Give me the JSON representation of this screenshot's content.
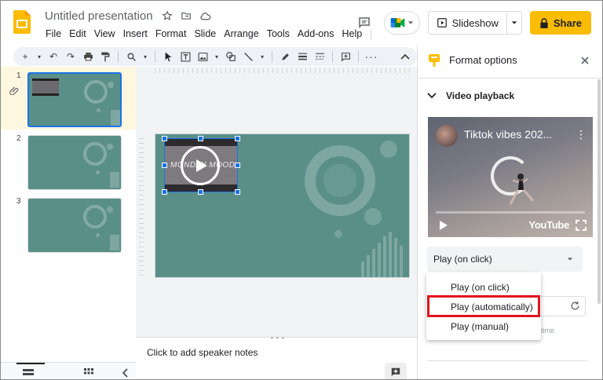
{
  "header": {
    "title": "Untitled presentation",
    "menu": [
      "File",
      "Edit",
      "View",
      "Insert",
      "Format",
      "Slide",
      "Arrange",
      "Tools",
      "Add-ons",
      "Help"
    ],
    "slideshow_label": "Slideshow",
    "share_label": "Share"
  },
  "colors": {
    "accent": "#1a73e8",
    "share": "#fbbc04",
    "slide_bg": "#5a8f88",
    "highlight": "#e0141e"
  },
  "filmstrip": {
    "slides": [
      "1",
      "2",
      "3"
    ]
  },
  "canvas": {
    "video_overlay_text": "MONDAY MOOD"
  },
  "notes": {
    "placeholder": "Click to add speaker notes"
  },
  "panel": {
    "title": "Format options",
    "section": "Video playback",
    "video_title": "Tiktok vibes 202...",
    "video_brand": "YouTube",
    "playback_selected": "Play (on click)",
    "playback_options": [
      "Play (on click)",
      "Play (automatically)",
      "Play (manual)"
    ],
    "hidden_hint": "t time"
  },
  "icons": [
    "star-icon",
    "folder-move-icon",
    "cloud-icon",
    "comment-icon",
    "meet-icon",
    "slideshow-icon",
    "lock-icon",
    "close-icon",
    "chevron-down-icon",
    "play-icon",
    "refresh-icon",
    "attachment-icon"
  ]
}
